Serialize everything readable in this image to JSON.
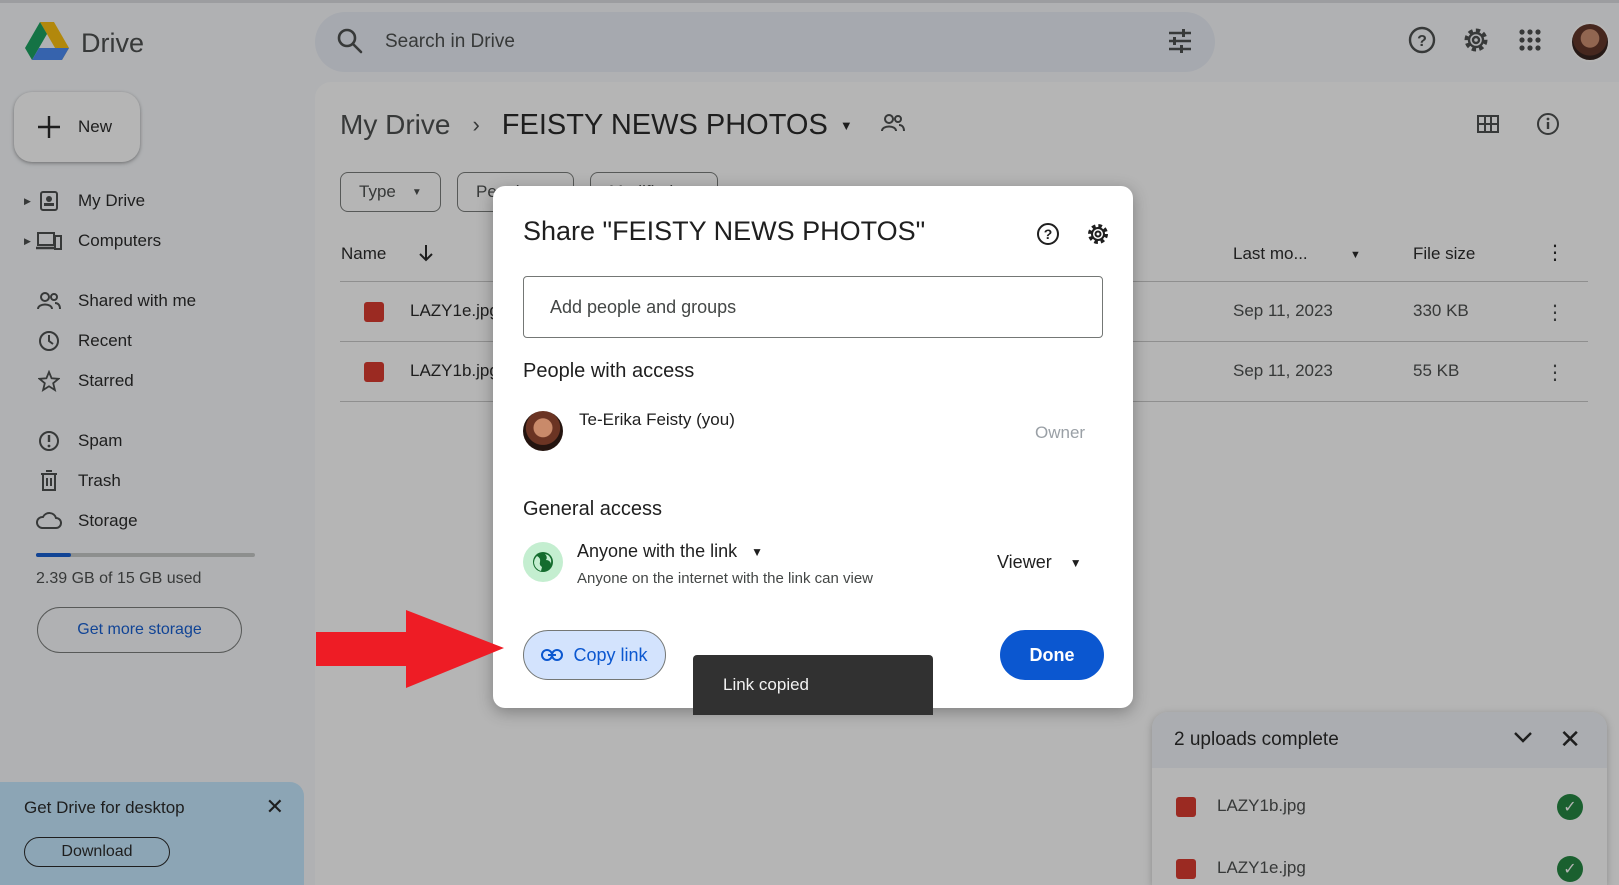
{
  "app": {
    "name": "Drive"
  },
  "search": {
    "placeholder": "Search in Drive"
  },
  "sidebar": {
    "new_label": "New",
    "items": [
      {
        "label": "My Drive"
      },
      {
        "label": "Computers"
      },
      {
        "label": "Shared with me"
      },
      {
        "label": "Recent"
      },
      {
        "label": "Starred"
      },
      {
        "label": "Spam"
      },
      {
        "label": "Trash"
      },
      {
        "label": "Storage"
      }
    ],
    "storage_used_fraction": 0.16,
    "storage_text": "2.39 GB of 15 GB used",
    "get_storage_label": "Get more storage"
  },
  "promo": {
    "title": "Get Drive for desktop",
    "download_label": "Download"
  },
  "breadcrumb": {
    "root": "My Drive",
    "folder": "FEISTY NEWS PHOTOS"
  },
  "filters": {
    "type": "Type",
    "people": "People",
    "modified": "Modified"
  },
  "table": {
    "headers": {
      "name": "Name",
      "last_modified": "Last mo...",
      "file_size": "File size"
    },
    "rows": [
      {
        "name": "LAZY1e.jpg",
        "date": "Sep 11, 2023",
        "size": "330 KB"
      },
      {
        "name": "LAZY1b.jpg",
        "date": "Sep 11, 2023",
        "size": "55 KB"
      }
    ]
  },
  "uploads": {
    "title": "2 uploads complete",
    "files": [
      {
        "name": "LAZY1b.jpg"
      },
      {
        "name": "LAZY1e.jpg"
      }
    ]
  },
  "dialog": {
    "title": "Share \"FEISTY NEWS PHOTOS\"",
    "add_placeholder": "Add people and groups",
    "people_heading": "People with access",
    "person_name": "Te-Erika Feisty (you)",
    "person_role": "Owner",
    "general_heading": "General access",
    "access_level": "Anyone with the link",
    "access_desc": "Anyone on the internet with the link can view",
    "role": "Viewer",
    "copy_link_label": "Copy link",
    "done_label": "Done"
  },
  "toast": {
    "text": "Link copied"
  },
  "colors": {
    "accent": "#0b57d0",
    "annotation_arrow": "#ee1c25"
  }
}
